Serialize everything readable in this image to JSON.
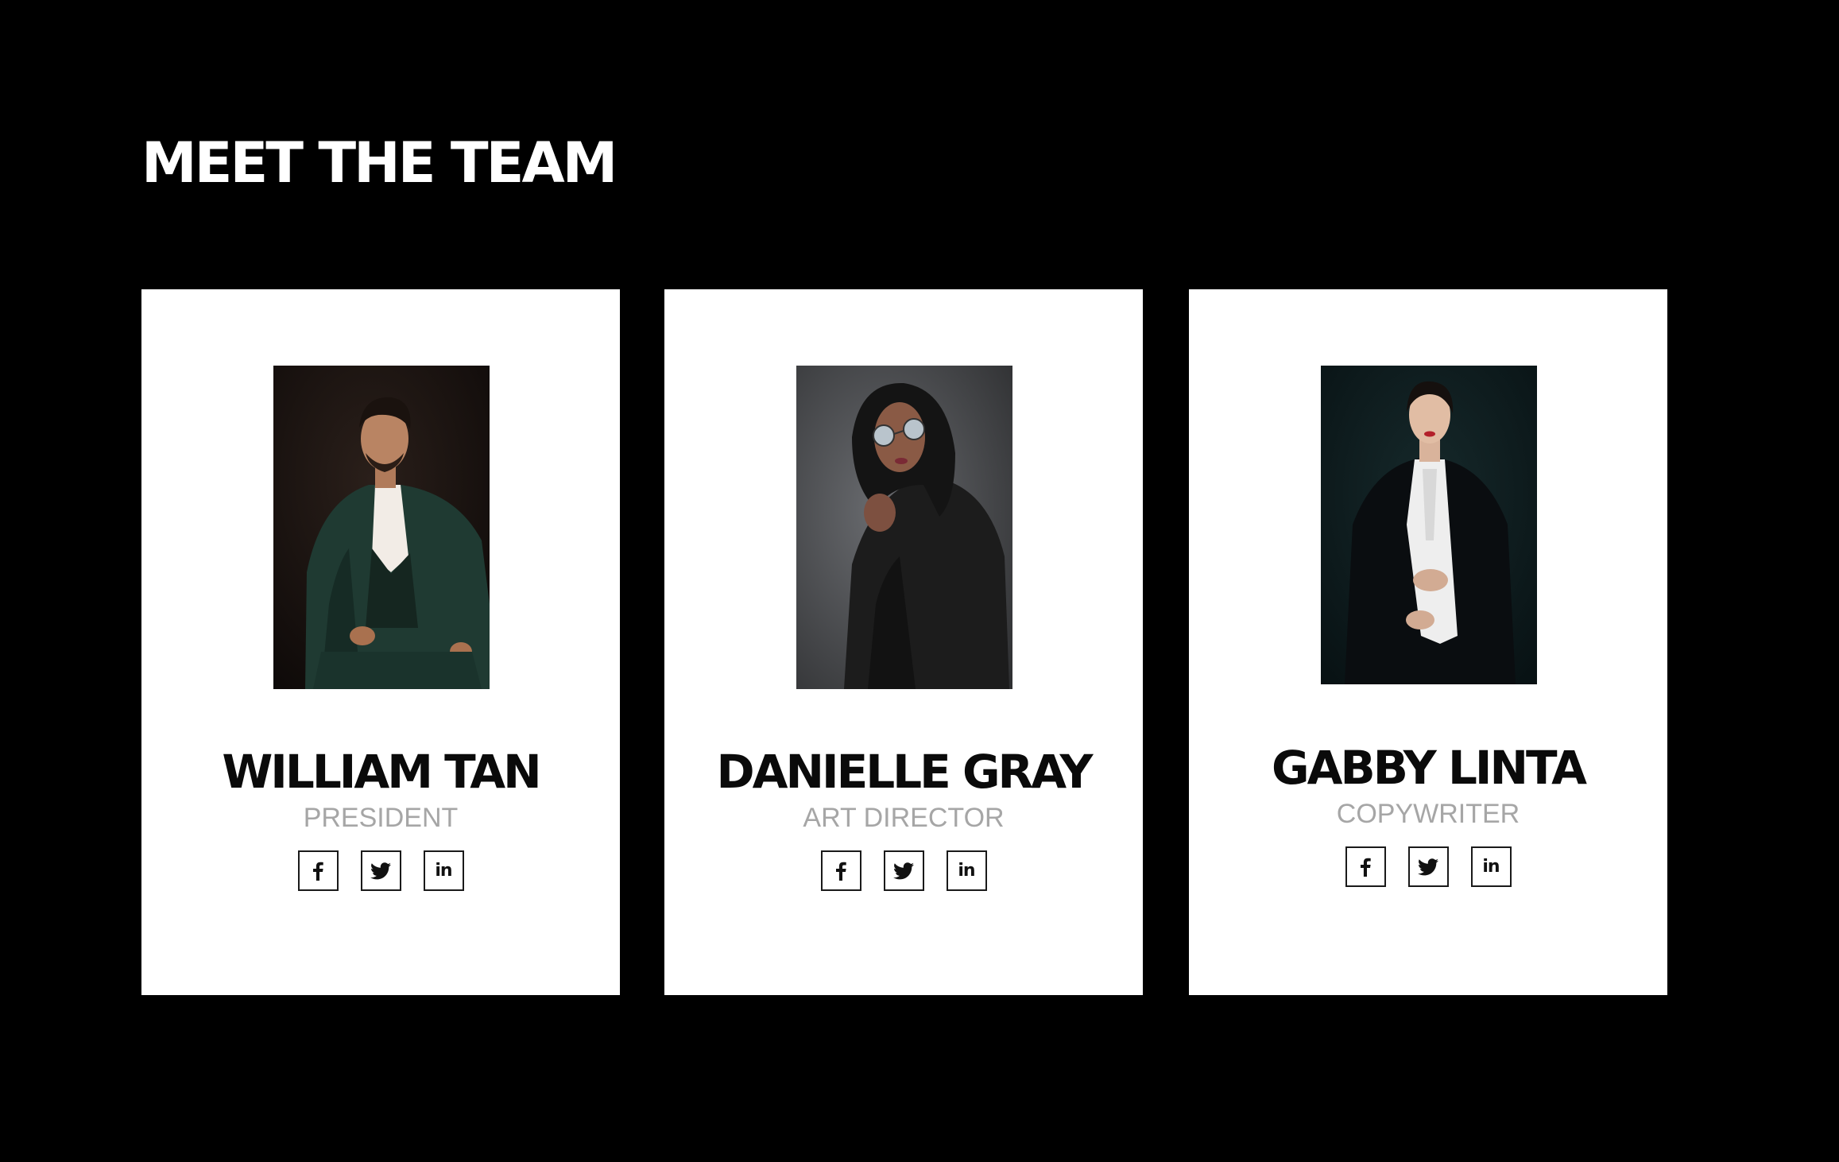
{
  "page": {
    "title": "MEET THE TEAM",
    "background_color": "#000000"
  },
  "team": [
    {
      "name": "WILLIAM TAN",
      "role": "PRESIDENT",
      "photo_colors": {
        "backdrop": "#1a1412",
        "outfit": "#1f3a32",
        "shirt": "#f2ece6"
      },
      "socials": [
        "facebook-icon",
        "twitter-icon",
        "linkedin-icon"
      ]
    },
    {
      "name": "DANIELLE GRAY",
      "role": "ART DIRECTOR",
      "photo_colors": {
        "backdrop": "#55575a",
        "outfit": "#1c1c1c",
        "shirt": "#262626"
      },
      "socials": [
        "facebook-icon",
        "twitter-icon",
        "linkedin-icon"
      ]
    },
    {
      "name": "GABBY LINTA",
      "role": "COPYWRITER",
      "photo_colors": {
        "backdrop": "#0c1a1c",
        "outfit": "#0a0d10",
        "shirt": "#eeeeee"
      },
      "socials": [
        "facebook-icon",
        "twitter-icon",
        "linkedin-icon"
      ]
    }
  ],
  "social_labels": {
    "linkedin": "in"
  },
  "colors": {
    "card": "#ffffff",
    "name_text": "#0a0a0a",
    "role_text": "#a6a6a6",
    "icon_border": "#1a1a1a"
  }
}
